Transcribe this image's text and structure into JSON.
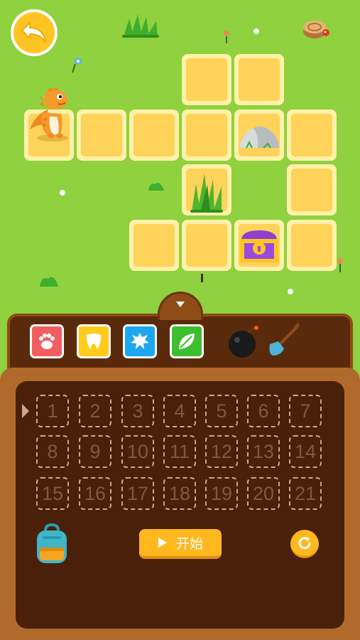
{
  "start_button": {
    "label": "开始",
    "play_icon": "play-icon"
  },
  "program_slots": [
    "1",
    "2",
    "3",
    "4",
    "5",
    "6",
    "7",
    "8",
    "9",
    "10",
    "11",
    "12",
    "13",
    "14",
    "15",
    "16",
    "17",
    "18",
    "19",
    "20",
    "21"
  ],
  "tools": [
    {
      "name": "paw-tool",
      "color": "#f25e60"
    },
    {
      "name": "tooth-tool",
      "color": "#ffcc1e"
    },
    {
      "name": "splash-tool",
      "color": "#1ea6f0"
    },
    {
      "name": "leaf-tool",
      "color": "#3dbe2e"
    }
  ],
  "items": [
    "bomb-icon",
    "shovel-icon"
  ],
  "board_objects": [
    "dinosaur",
    "rock",
    "grass-bush",
    "treasure-chest"
  ],
  "colors": {
    "grass": "#8fd13f",
    "tile": "#ffd35a",
    "wood": "#b06a2b",
    "accent": "#ffb81e"
  }
}
